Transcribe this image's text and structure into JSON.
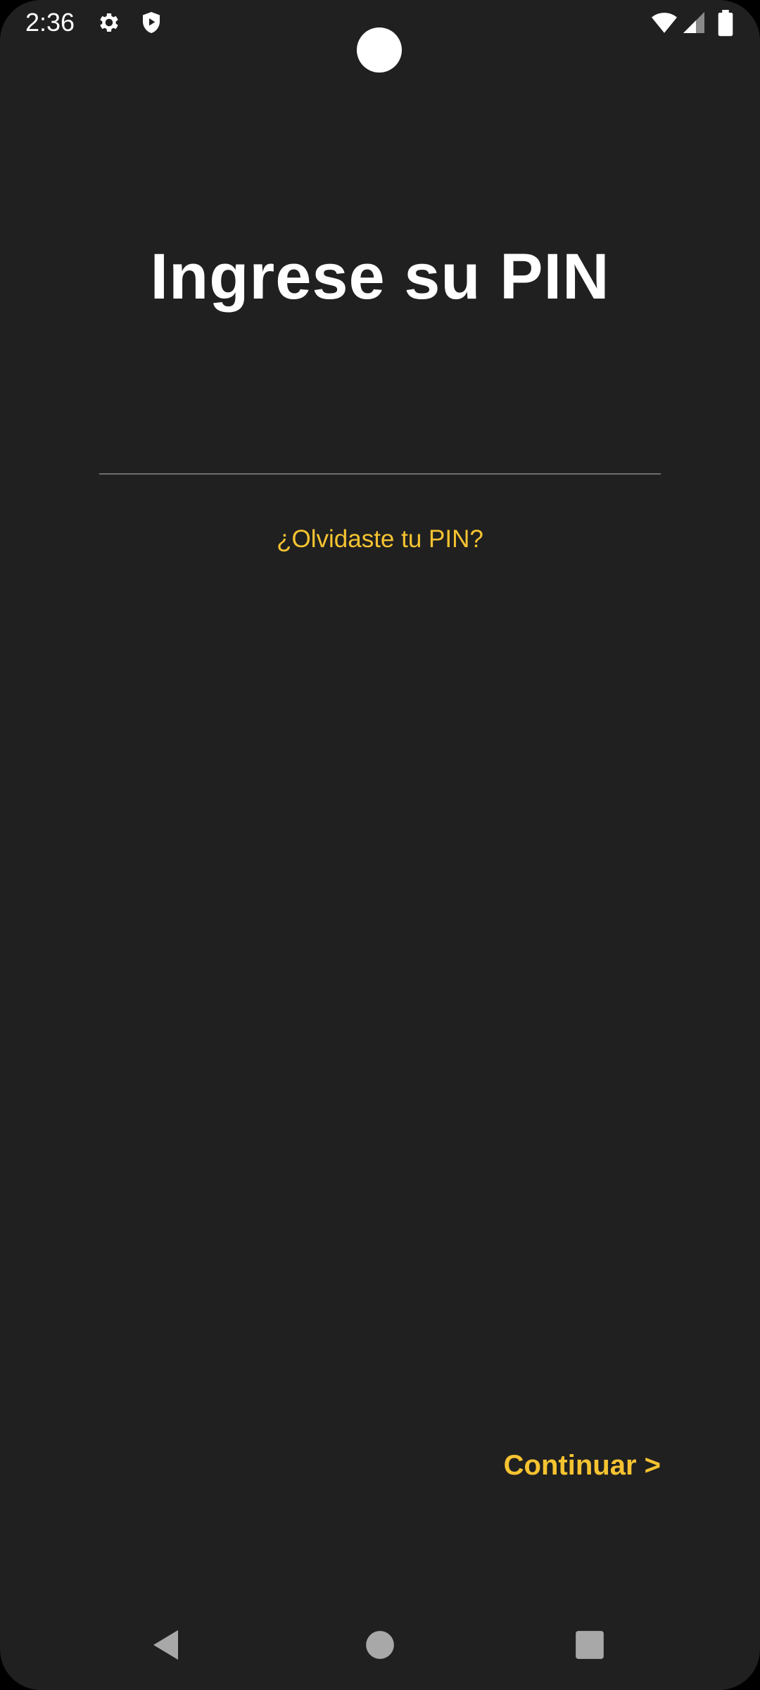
{
  "status_bar": {
    "time": "2:36",
    "icons": [
      "gear-icon",
      "shield-play-icon",
      "wifi-icon",
      "signal-icon",
      "battery-icon"
    ]
  },
  "main": {
    "title": "Ingrese su PIN",
    "pin_field": {
      "value": "",
      "placeholder": ""
    },
    "forgot_link": "¿Olvidaste tu PIN?",
    "continue_label": "Continuar >"
  },
  "nav_bar": {
    "buttons": [
      "back-icon",
      "home-icon",
      "recents-icon"
    ]
  },
  "colors": {
    "background": "#202020",
    "accent": "#f5c331",
    "text": "#ffffff",
    "divider": "#6e6e6e"
  }
}
